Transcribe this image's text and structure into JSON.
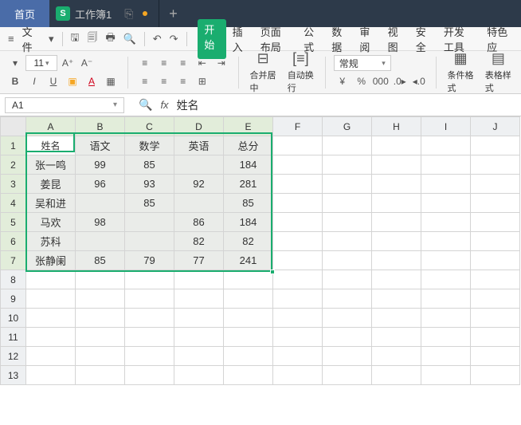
{
  "titlebar": {
    "home_tab": "首页",
    "workbook_tab": "工作簿1",
    "s_badge": "S"
  },
  "menubar": {
    "file_label": "文件",
    "tabs": [
      "开始",
      "插入",
      "页面布局",
      "公式",
      "数据",
      "审阅",
      "视图",
      "安全",
      "开发工具",
      "特色应"
    ]
  },
  "ribbon": {
    "font_size": "11",
    "merge_label": "合并居中",
    "wrap_label": "自动换行",
    "num_format": "常规",
    "cond_fmt": "条件格式",
    "table_style": "表格样式"
  },
  "namebox": {
    "ref": "A1",
    "formula_value": "姓名"
  },
  "columns": [
    "A",
    "B",
    "C",
    "D",
    "E",
    "F",
    "G",
    "H",
    "I",
    "J"
  ],
  "row_numbers": [
    "1",
    "2",
    "3",
    "4",
    "5",
    "6",
    "7",
    "8",
    "9",
    "10",
    "11",
    "12",
    "13"
  ],
  "headers": [
    "姓名",
    "语文",
    "数学",
    "英语",
    "总分"
  ],
  "data": [
    [
      "张一鸣",
      "99",
      "85",
      "",
      "184"
    ],
    [
      "姜昆",
      "96",
      "93",
      "92",
      "281"
    ],
    [
      "吴和进",
      "",
      "85",
      "",
      "85"
    ],
    [
      "马欢",
      "98",
      "",
      "86",
      "184"
    ],
    [
      "苏科",
      "",
      "",
      "82",
      "82"
    ],
    [
      "张静阑",
      "85",
      "79",
      "77",
      "241"
    ]
  ]
}
